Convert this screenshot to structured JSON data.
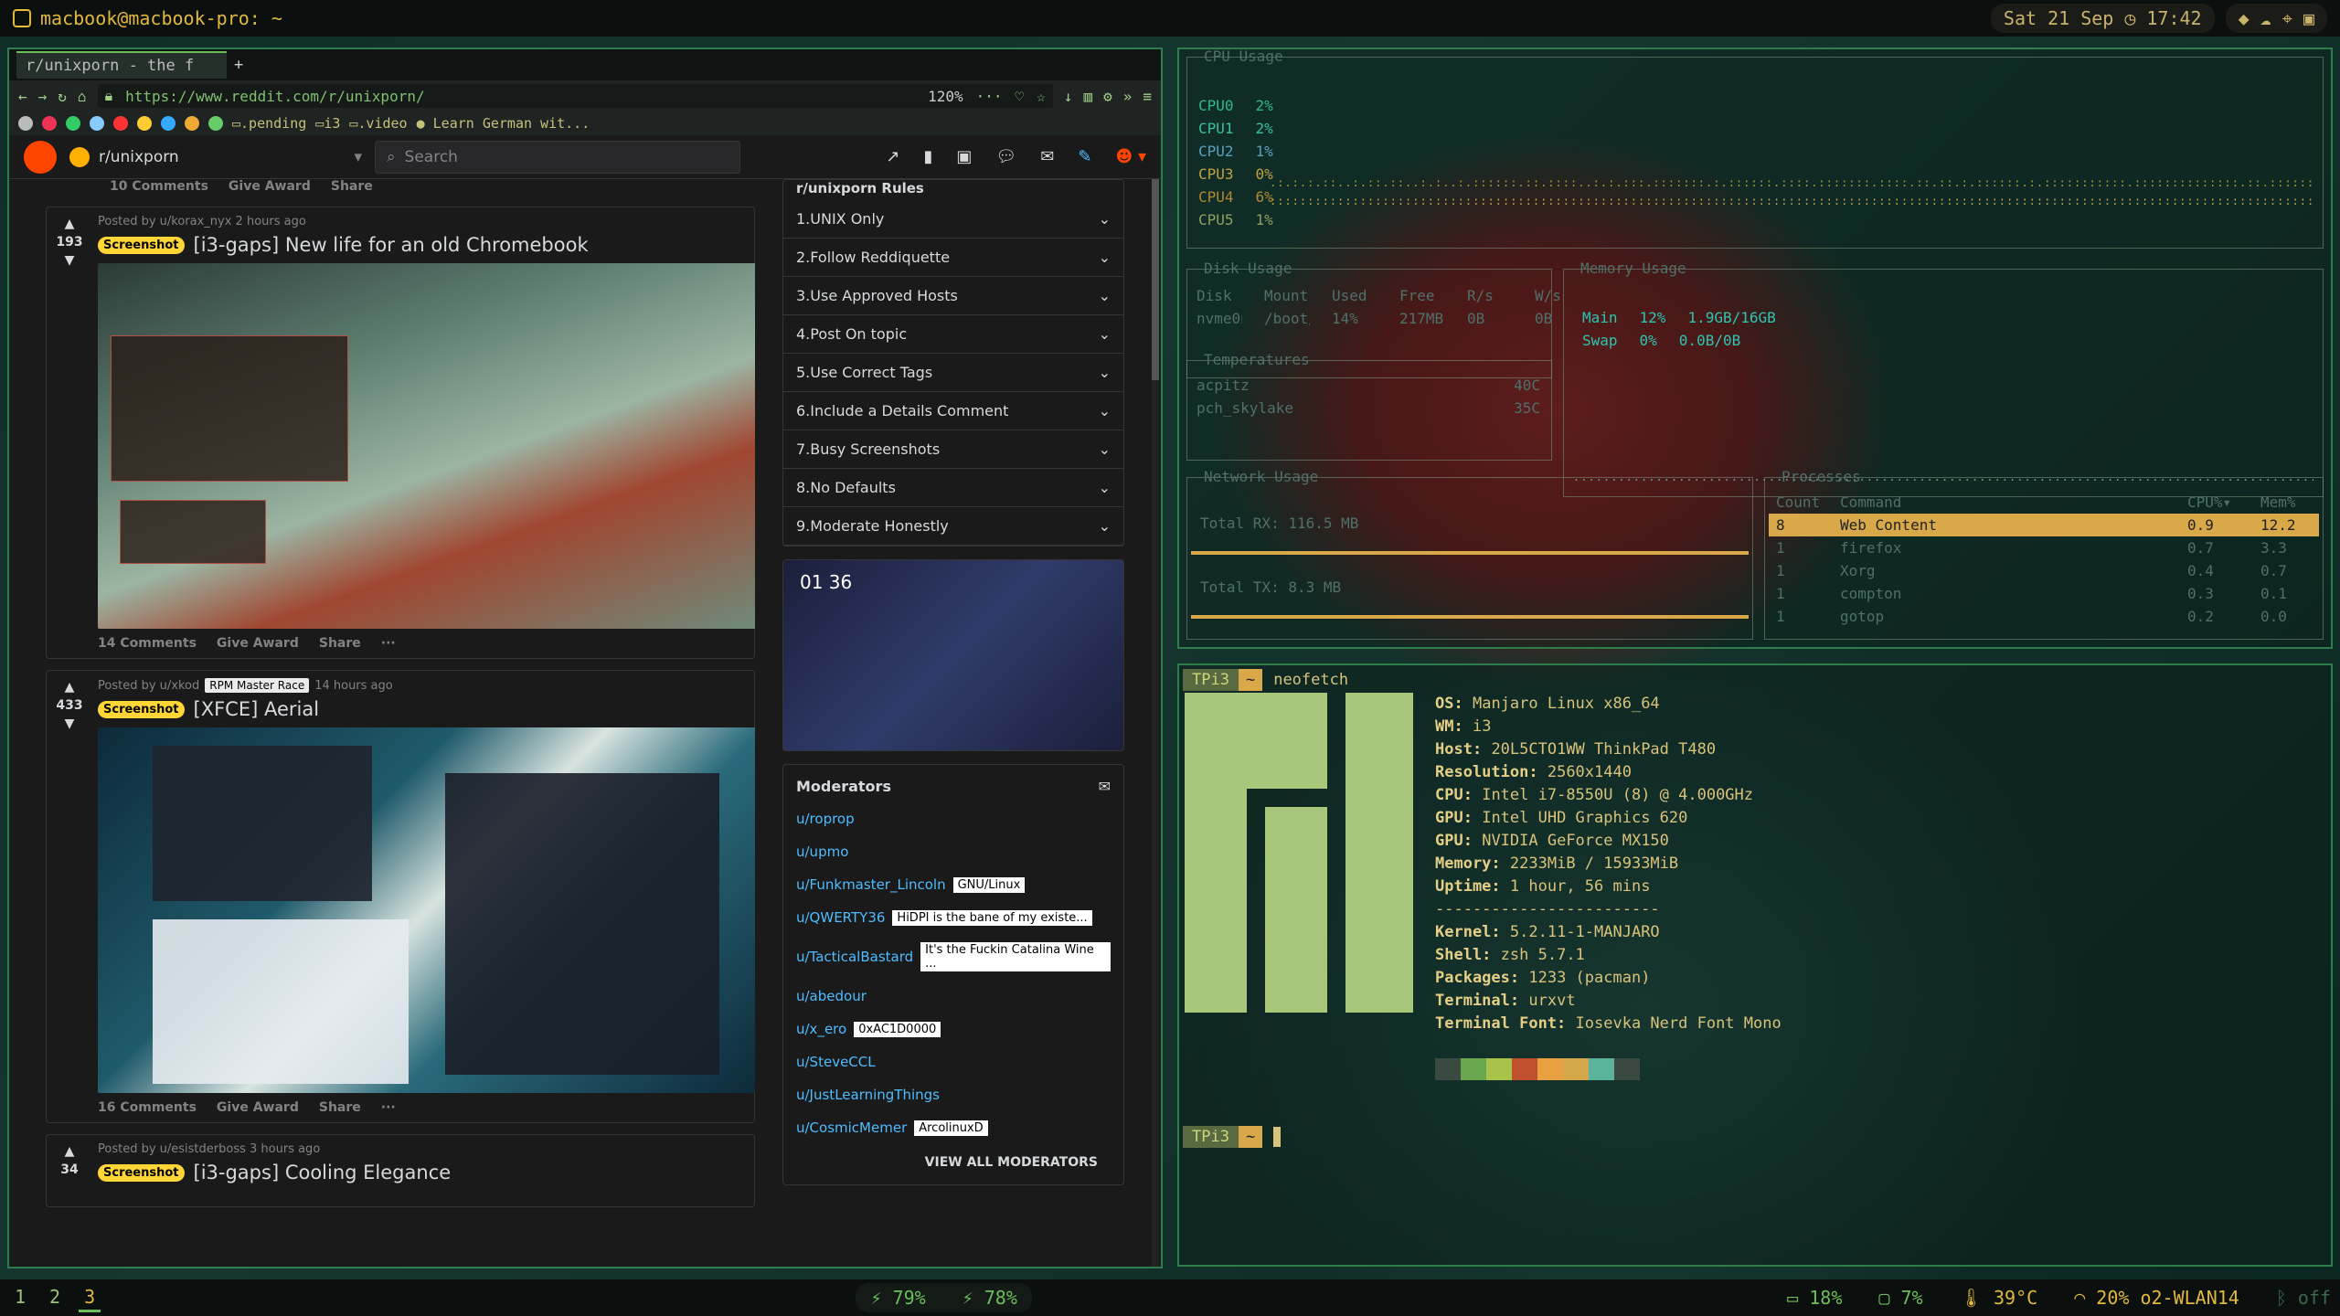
{
  "topbar": {
    "host": "macbook@macbook-pro: ~",
    "date": "Sat 21 Sep",
    "time": "17:42"
  },
  "firefox": {
    "tab_title": "r/unixporn - the f",
    "new_tab": "+",
    "url": "https://www.reddit.com/r/unixporn/",
    "zoom": "120%",
    "bookmarks": [
      ".pending",
      "i3",
      ".video",
      "Learn German wit..."
    ],
    "subreddit": "r/unixporn",
    "search_placeholder": "Search"
  },
  "feed": {
    "prev_actions": {
      "comments": "10 Comments",
      "award": "Give Award",
      "share": "Share"
    },
    "posts": [
      {
        "votes": "193",
        "meta": "Posted by u/korax_nyx 2 hours ago",
        "flair": "Screenshot",
        "title": "[i3-gaps] New life for an old Chromebook",
        "comments": "14 Comments",
        "award": "Give Award",
        "share": "Share"
      },
      {
        "votes": "433",
        "meta_pre": "Posted by u/xkod",
        "user_flair": "RPM Master Race",
        "meta_post": "14 hours ago",
        "flair": "Screenshot",
        "title": "[XFCE] Aerial",
        "comments": "16 Comments",
        "award": "Give Award",
        "share": "Share"
      },
      {
        "votes": "34",
        "meta": "Posted by u/esistderboss 3 hours ago",
        "flair": "Screenshot",
        "title": "[i3-gaps] Cooling Elegance"
      }
    ]
  },
  "sidebar": {
    "rules_title": "r/unixporn Rules",
    "rules": [
      "1.UNIX Only",
      "2.Follow Reddiquette",
      "3.Use Approved Hosts",
      "4.Post On topic",
      "5.Use Correct Tags",
      "6.Include a Details Comment",
      "7.Busy Screenshots",
      "8.No Defaults",
      "9.Moderate Honestly"
    ],
    "promo_time": "01 36",
    "moderators_title": "Moderators",
    "moderators": [
      {
        "name": "u/roprop",
        "flair": ""
      },
      {
        "name": "u/upmo",
        "flair": ""
      },
      {
        "name": "u/Funkmaster_Lincoln",
        "flair": "GNU/Linux"
      },
      {
        "name": "u/QWERTY36",
        "flair": "HiDPI is the bane of my existe..."
      },
      {
        "name": "u/TacticalBastard",
        "flair": "It's the Fuckin Catalina Wine ..."
      },
      {
        "name": "u/abedour",
        "flair": ""
      },
      {
        "name": "u/x_ero",
        "flair": "0xAC1D0000"
      },
      {
        "name": "u/SteveCCL",
        "flair": ""
      },
      {
        "name": "u/JustLearningThings",
        "flair": ""
      },
      {
        "name": "u/CosmicMemer",
        "flair": "ArcolinuxD"
      }
    ],
    "view_all": "VIEW ALL MODERATORS"
  },
  "conky": {
    "cpu_title": "CPU Usage",
    "cpus": [
      {
        "name": "CPU0",
        "pct": "2%"
      },
      {
        "name": "CPU1",
        "pct": "2%"
      },
      {
        "name": "CPU2",
        "pct": "1%"
      },
      {
        "name": "CPU3",
        "pct": "0%"
      },
      {
        "name": "CPU4",
        "pct": "6%"
      },
      {
        "name": "CPU5",
        "pct": "1%"
      }
    ],
    "disk_title": "Disk Usage",
    "disk_headers": [
      "Disk",
      "Mount",
      "Used",
      "Free",
      "R/s",
      "W/s"
    ],
    "disk_row": [
      "nvme0n",
      "/boot/",
      "14%",
      "217MB",
      "0B",
      "0B"
    ],
    "mem_title": "Memory Usage",
    "mem_rows": [
      [
        "Main",
        "12%",
        "1.9GB/16GB"
      ],
      [
        "Swap",
        "0%",
        "0.0B/0B"
      ]
    ],
    "temp_title": "Temperatures",
    "temps": [
      [
        "acpitz",
        "40C"
      ],
      [
        "pch_skylake",
        "35C"
      ]
    ],
    "net_title": "Network Usage",
    "net_rx": "Total RX: 116.5 MB",
    "net_tx": "Total TX:  8.3 MB",
    "proc_title": "Processes",
    "proc_headers": [
      "Count",
      "Command",
      "CPU%▾",
      "Mem%"
    ],
    "procs": [
      [
        "8",
        "Web Content",
        "0.9",
        "12.2"
      ],
      [
        "1",
        "firefox",
        "0.7",
        "3.3"
      ],
      [
        "1",
        "Xorg",
        "0.4",
        "0.7"
      ],
      [
        "1",
        "compton",
        "0.3",
        "0.1"
      ],
      [
        "1",
        "gotop",
        "0.2",
        "0.0"
      ]
    ]
  },
  "terminal": {
    "prompt_host": "TPi3",
    "prompt_dir": "~",
    "cmd": "neofetch",
    "info": [
      [
        "OS:",
        "Manjaro Linux x86_64"
      ],
      [
        "WM:",
        "i3"
      ],
      [
        "Host:",
        "20L5CTO1WW ThinkPad T480"
      ],
      [
        "Resolution:",
        "2560x1440"
      ],
      [
        "CPU:",
        "Intel i7-8550U (8) @ 4.000GHz"
      ],
      [
        "GPU:",
        "Intel UHD Graphics 620"
      ],
      [
        "GPU:",
        "NVIDIA GeForce MX150"
      ],
      [
        "Memory:",
        "2233MiB / 15933MiB"
      ],
      [
        "Uptime:",
        "1 hour, 56 mins"
      ]
    ],
    "sep": "------------------------",
    "info2": [
      [
        "Kernel:",
        "5.2.11-1-MANJARO"
      ],
      [
        "Shell:",
        "zsh 5.7.1"
      ],
      [
        "Packages:",
        "1233 (pacman)"
      ],
      [
        "Terminal:",
        "urxvt"
      ],
      [
        "Terminal Font:",
        "Iosevka Nerd Font Mono"
      ]
    ],
    "palette": [
      "#3a4a40",
      "#6aa84f",
      "#a9c24a",
      "#c0502e",
      "#e8a040",
      "#d4a84a",
      "#5ab39a",
      "#3a4a40"
    ]
  },
  "bottombar": {
    "workspaces": [
      "1",
      "2",
      "3"
    ],
    "bat1": "79%",
    "bat2": "78%",
    "mem": "18%",
    "disp": "7%",
    "temp": "39°C",
    "wifi": "20% o2-WLAN14",
    "bt": "off"
  },
  "colors": {
    "accent": "#6bbf59",
    "reddit_orange": "#ff4500",
    "flair": "#ffd635",
    "conky_highlight": "#d9a848"
  }
}
